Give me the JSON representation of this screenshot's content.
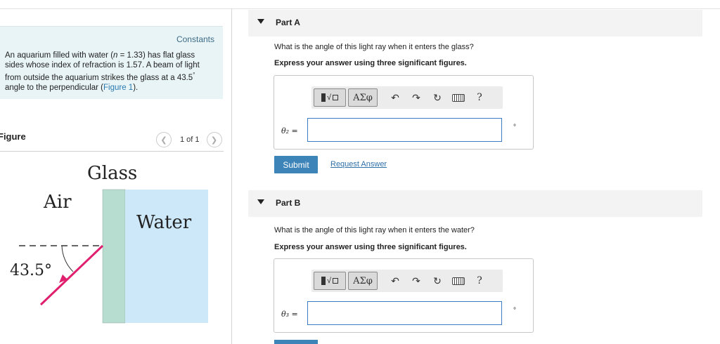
{
  "problem": {
    "constants_label": "Constants",
    "text_1": "An aquarium filled with water (",
    "n_symbol": "n",
    "text_2": " = 1.33) has flat glass sides whose index of refraction is 1.57. A beam of light from outside the aquarium strikes the glass at a 43.5",
    "degree_sup": "°",
    "text_3": " angle to the perpendicular (",
    "figure_link": "Figure 1",
    "text_4": ")."
  },
  "figure": {
    "heading": "Figure",
    "pager_text": "1 of 1",
    "prev_icon": "chevron-left-icon",
    "next_icon": "chevron-right-icon",
    "label_glass": "Glass",
    "label_air": "Air",
    "label_water": "Water",
    "label_angle": "43.5°",
    "colors": {
      "glass": "#b7ddd0",
      "water": "#cde8f9",
      "ray": "#e0206e"
    }
  },
  "parts": [
    {
      "title": "Part A",
      "question": "What is the angle of this light ray when it enters the glass?",
      "instruction": "Express your answer using three significant figures.",
      "var_label": "θ₂ =",
      "input_value": "",
      "unit": "°",
      "toolbar": {
        "symbols": "ΑΣφ",
        "help": "?"
      },
      "submit_label": "Submit",
      "request_label": "Request Answer"
    },
    {
      "title": "Part B",
      "question": "What is the angle of this light ray when it enters the water?",
      "instruction": "Express your answer using three significant figures.",
      "var_label": "θ₃ =",
      "input_value": "",
      "unit": "°",
      "toolbar": {
        "symbols": "ΑΣφ",
        "help": "?"
      }
    }
  ],
  "colors": {
    "accent": "#3d84b8",
    "link": "#2f70a8",
    "problem_bg": "#e9f4f7",
    "part_header_bg": "#f3f3f3"
  }
}
